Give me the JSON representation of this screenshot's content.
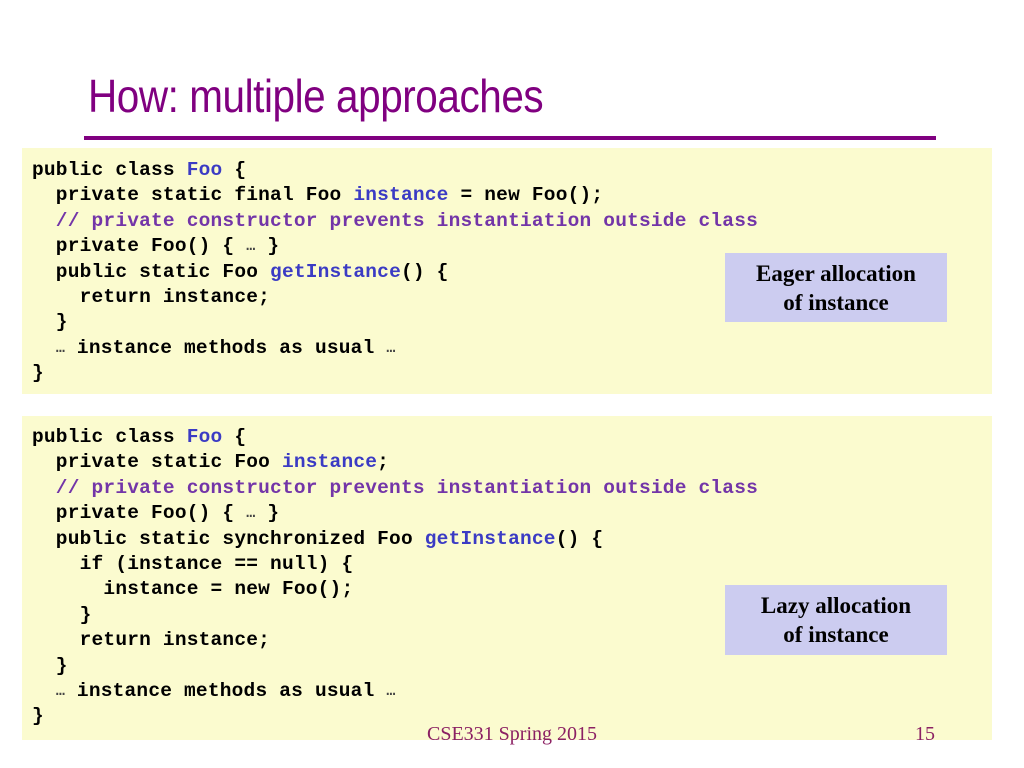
{
  "slide": {
    "title": "How: multiple approaches",
    "accent_color": "#800080",
    "code_bg_color": "#fbfbcf",
    "callout_bg_color": "#ccccf0",
    "identifier_color": "#3b3bc4",
    "comment_color": "#7335a8"
  },
  "code_eager": {
    "lines": [
      [
        {
          "t": "public class ",
          "c": "kw"
        },
        {
          "t": "Foo",
          "c": "id"
        },
        {
          "t": " {",
          "c": "kw"
        }
      ],
      [
        {
          "t": "  private static final Foo ",
          "c": "kw"
        },
        {
          "t": "instance",
          "c": "id"
        },
        {
          "t": " = new Foo();",
          "c": "kw"
        }
      ],
      [
        {
          "t": "  // private constructor prevents instantiation outside class",
          "c": "cmt"
        }
      ],
      [
        {
          "t": "  private Foo() { ",
          "c": "kw"
        },
        {
          "t": "…",
          "c": "ell"
        },
        {
          "t": " }",
          "c": "kw"
        }
      ],
      [
        {
          "t": "  public static Foo ",
          "c": "kw"
        },
        {
          "t": "getInstance",
          "c": "id"
        },
        {
          "t": "() {",
          "c": "kw"
        }
      ],
      [
        {
          "t": "    return instance;",
          "c": "kw"
        }
      ],
      [
        {
          "t": "  }",
          "c": "kw"
        }
      ],
      [
        {
          "t": "  ",
          "c": "kw"
        },
        {
          "t": "…",
          "c": "ell"
        },
        {
          "t": " instance methods as usual ",
          "c": "kw"
        },
        {
          "t": "…",
          "c": "ell"
        }
      ],
      [
        {
          "t": "}",
          "c": "kw"
        }
      ]
    ]
  },
  "code_lazy": {
    "lines": [
      [
        {
          "t": "public class ",
          "c": "kw"
        },
        {
          "t": "Foo",
          "c": "id"
        },
        {
          "t": " {",
          "c": "kw"
        }
      ],
      [
        {
          "t": "  private static Foo ",
          "c": "kw"
        },
        {
          "t": "instance",
          "c": "id"
        },
        {
          "t": ";",
          "c": "kw"
        }
      ],
      [
        {
          "t": "  // private constructor prevents instantiation outside class",
          "c": "cmt"
        }
      ],
      [
        {
          "t": "  private Foo() { ",
          "c": "kw"
        },
        {
          "t": "…",
          "c": "ell"
        },
        {
          "t": " }",
          "c": "kw"
        }
      ],
      [
        {
          "t": "  public static synchronized Foo ",
          "c": "kw"
        },
        {
          "t": "getInstance",
          "c": "id"
        },
        {
          "t": "() {",
          "c": "kw"
        }
      ],
      [
        {
          "t": "    if (instance == null) {",
          "c": "kw"
        }
      ],
      [
        {
          "t": "      instance = new Foo();",
          "c": "kw"
        }
      ],
      [
        {
          "t": "    }",
          "c": "kw"
        }
      ],
      [
        {
          "t": "    return instance;",
          "c": "kw"
        }
      ],
      [
        {
          "t": "  }",
          "c": "kw"
        }
      ],
      [
        {
          "t": "  ",
          "c": "kw"
        },
        {
          "t": "…",
          "c": "ell"
        },
        {
          "t": " instance methods as usual ",
          "c": "kw"
        },
        {
          "t": "…",
          "c": "ell"
        }
      ],
      [
        {
          "t": "}",
          "c": "kw"
        }
      ]
    ]
  },
  "callout_eager": {
    "line1": "Eager allocation",
    "line2": "of instance"
  },
  "callout_lazy": {
    "line1": "Lazy allocation",
    "line2": "of instance"
  },
  "footer": {
    "course": "CSE331 Spring 2015",
    "page_number": "15"
  }
}
